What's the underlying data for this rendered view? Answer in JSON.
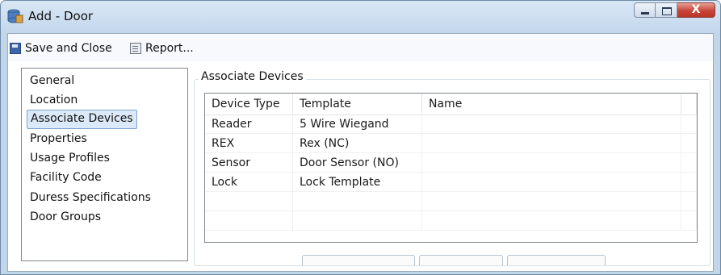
{
  "window": {
    "title": "Add - Door",
    "minimize_glyph": "",
    "maximize_glyph": "",
    "close_glyph": "X"
  },
  "toolbar": {
    "save_label": "Save and Close",
    "report_label": "Report..."
  },
  "nav": {
    "items": [
      {
        "label": "General"
      },
      {
        "label": "Location"
      },
      {
        "label": "Associate Devices",
        "selected": true
      },
      {
        "label": "Properties"
      },
      {
        "label": "Usage Profiles"
      },
      {
        "label": "Facility Code"
      },
      {
        "label": "Duress Specifications"
      },
      {
        "label": "Door Groups"
      }
    ]
  },
  "panel": {
    "title": "Associate Devices",
    "columns": [
      "Device Type",
      "Template",
      "Name"
    ],
    "rows": [
      [
        "Reader",
        "5 Wire Wiegand",
        ""
      ],
      [
        "REX",
        "Rex (NC)",
        ""
      ],
      [
        "Sensor",
        "Door Sensor (NO)",
        ""
      ],
      [
        "Lock",
        "Lock Template",
        ""
      ],
      [
        "",
        "",
        ""
      ],
      [
        "",
        "",
        ""
      ]
    ]
  },
  "colors": {
    "titlebar": "#c3d7ec",
    "selection": "#dce9f8",
    "close_button": "#c8453a"
  }
}
